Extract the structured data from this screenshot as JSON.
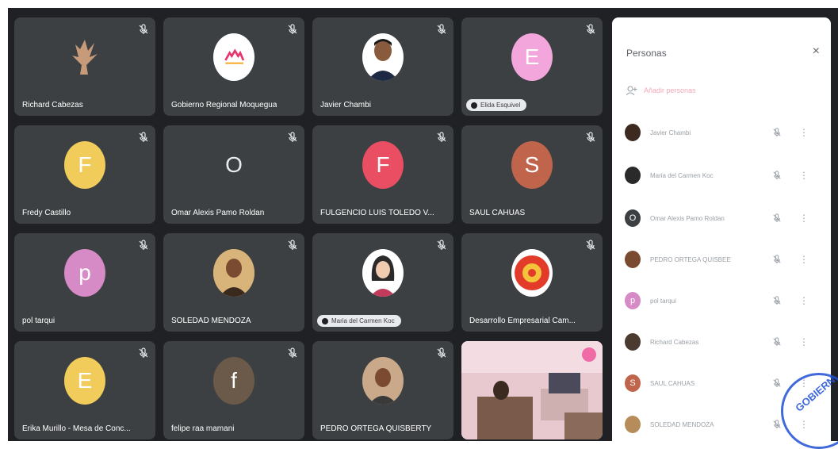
{
  "tiles": [
    {
      "name": "Richard Cabezas",
      "avatar": "",
      "avatar_color": "#3c4043"
    },
    {
      "name": "Gobierno Regional Moquegua",
      "avatar": "",
      "avatar_color": "#ffffff"
    },
    {
      "name": "Javier Chambi",
      "avatar": "",
      "avatar_color": "#ffffff"
    },
    {
      "name": "Elida Esquivel",
      "avatar": "E",
      "avatar_color": "#f3a6dc"
    },
    {
      "name": "Fredy Castillo",
      "avatar": "F",
      "avatar_color": "#f2cc5a"
    },
    {
      "name": "Omar Alexis Pamo Roldan",
      "avatar": "O",
      "avatar_color": "#3c4043"
    },
    {
      "name": "FULGENCIO LUIS TOLEDO V...",
      "avatar": "F",
      "avatar_color": "#e94e63"
    },
    {
      "name": "SAUL CAHUAS",
      "avatar": "S",
      "avatar_color": "#c0654c"
    },
    {
      "name": "pol tarqui",
      "avatar": "p",
      "avatar_color": "#d68ac6"
    },
    {
      "name": "SOLEDAD MENDOZA",
      "avatar": "",
      "avatar_color": "#b58c5a"
    },
    {
      "name": "Maria del Carmen Koc",
      "avatar": "",
      "avatar_color": "#ffffff"
    },
    {
      "name": "Desarrollo Empresarial Cam...",
      "avatar": "",
      "avatar_color": "#e23b2a"
    },
    {
      "name": "Erika Murillo - Mesa de Conc...",
      "avatar": "E",
      "avatar_color": "#f2cc5a"
    },
    {
      "name": "felipe raa mamani",
      "avatar": "f",
      "avatar_color": "#6b5a4a"
    },
    {
      "name": "PEDRO ORTEGA QUISBERTY",
      "avatar": "",
      "avatar_color": "#a97a58"
    }
  ],
  "panel": {
    "title": "Personas",
    "close": "×",
    "add_people": "Añadir personas",
    "people": [
      {
        "name": "Javier Chambi",
        "avatar": "",
        "color": "#3c2a20"
      },
      {
        "name": "Maria del Carmen Koc",
        "avatar": "",
        "color": "#2a2a2a"
      },
      {
        "name": "Omar Alexis Pamo Roldan",
        "avatar": "O",
        "color": "#3c4043"
      },
      {
        "name": "PEDRO ORTEGA QUISBEE",
        "avatar": "",
        "color": "#7a4b30"
      },
      {
        "name": "pol tarqui",
        "avatar": "p",
        "color": "#d68ac6"
      },
      {
        "name": "Richard Cabezas",
        "avatar": "",
        "color": "#4a3a30"
      },
      {
        "name": "SAUL CAHUAS",
        "avatar": "S",
        "color": "#c0654c"
      },
      {
        "name": "SOLEDAD MENDOZA",
        "avatar": "",
        "color": "#b58c5a"
      }
    ],
    "more": "⋮"
  },
  "stamp_text": "GOBIERN"
}
